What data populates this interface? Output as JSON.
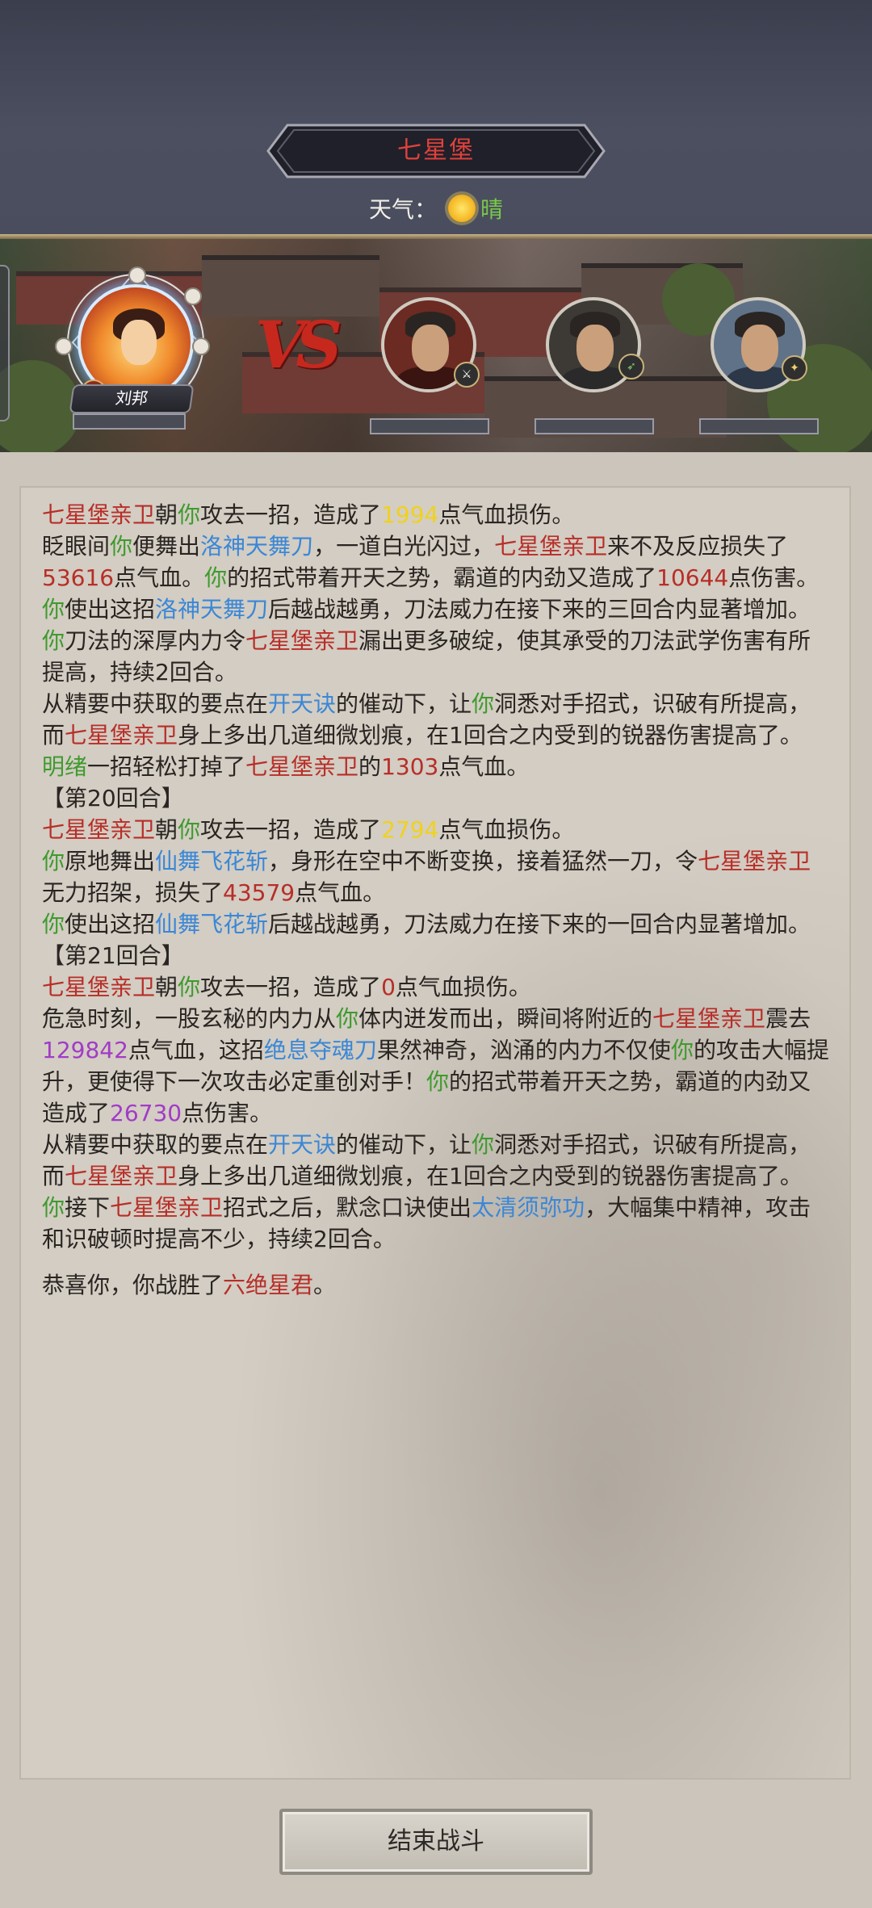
{
  "header": {
    "location": "七星堡",
    "weather_label": "天气：",
    "weather_icon": "sun-icon",
    "weather_value": "晴"
  },
  "battle": {
    "player_name": "刘邦",
    "vs_label": "VS"
  },
  "log": [
    {
      "parts": [
        {
          "t": "七星堡亲卫",
          "c": "red"
        },
        {
          "t": "朝"
        },
        {
          "t": "你",
          "c": "green"
        },
        {
          "t": "攻去一招，造成了"
        },
        {
          "t": "1994",
          "c": "yellow"
        },
        {
          "t": "点气血损伤。"
        }
      ]
    },
    {
      "parts": [
        {
          "t": "眨眼间"
        },
        {
          "t": "你",
          "c": "green"
        },
        {
          "t": "便舞出"
        },
        {
          "t": "洛神天舞刀",
          "c": "blue"
        },
        {
          "t": "，一道白光闪过，"
        },
        {
          "t": "七星堡亲卫",
          "c": "red"
        },
        {
          "t": "来不及反应损失了"
        },
        {
          "t": "53616",
          "c": "red"
        },
        {
          "t": "点气血。"
        },
        {
          "t": "你",
          "c": "green"
        },
        {
          "t": "的招式带着开天之势，霸道的内劲又造成了"
        },
        {
          "t": "10644",
          "c": "red"
        },
        {
          "t": "点伤害。"
        }
      ]
    },
    {
      "parts": [
        {
          "t": "你",
          "c": "green"
        },
        {
          "t": "使出这招"
        },
        {
          "t": "洛神天舞刀",
          "c": "blue"
        },
        {
          "t": "后越战越勇，刀法威力在接下来的三回合内显著增加。"
        }
      ]
    },
    {
      "parts": [
        {
          "t": "你",
          "c": "green"
        },
        {
          "t": "刀法的深厚内力令"
        },
        {
          "t": "七星堡亲卫",
          "c": "red"
        },
        {
          "t": "漏出更多破绽，使其承受的刀法武学伤害有所提高，持续2回合。"
        }
      ]
    },
    {
      "parts": [
        {
          "t": "从精要中获取的要点在"
        },
        {
          "t": "开天诀",
          "c": "blue"
        },
        {
          "t": "的催动下，让"
        },
        {
          "t": "你",
          "c": "green"
        },
        {
          "t": "洞悉对手招式，识破有所提高，而"
        },
        {
          "t": "七星堡亲卫",
          "c": "red"
        },
        {
          "t": "身上多出几道细微划痕，在1回合之内受到的锐器伤害提高了。"
        }
      ]
    },
    {
      "parts": [
        {
          "t": "明绪",
          "c": "green"
        },
        {
          "t": "一招轻松打掉了"
        },
        {
          "t": "七星堡亲卫",
          "c": "red"
        },
        {
          "t": "的"
        },
        {
          "t": "1303",
          "c": "red"
        },
        {
          "t": "点气血。"
        }
      ]
    },
    {
      "round": true,
      "parts": [
        {
          "t": "【第20回合】"
        }
      ]
    },
    {
      "parts": [
        {
          "t": "七星堡亲卫",
          "c": "red"
        },
        {
          "t": "朝"
        },
        {
          "t": "你",
          "c": "green"
        },
        {
          "t": "攻去一招，造成了"
        },
        {
          "t": "2794",
          "c": "yellow"
        },
        {
          "t": "点气血损伤。"
        }
      ]
    },
    {
      "parts": [
        {
          "t": "你",
          "c": "green"
        },
        {
          "t": "原地舞出"
        },
        {
          "t": "仙舞飞花斩",
          "c": "blue"
        },
        {
          "t": "，身形在空中不断变换，接着猛然一刀，令"
        },
        {
          "t": "七星堡亲卫",
          "c": "red"
        },
        {
          "t": "无力招架，损失了"
        },
        {
          "t": "43579",
          "c": "red"
        },
        {
          "t": "点气血。"
        }
      ]
    },
    {
      "parts": [
        {
          "t": "你",
          "c": "green"
        },
        {
          "t": "使出这招"
        },
        {
          "t": "仙舞飞花斩",
          "c": "blue"
        },
        {
          "t": "后越战越勇，刀法威力在接下来的一回合内显著增加。"
        }
      ]
    },
    {
      "round": true,
      "parts": [
        {
          "t": "【第21回合】"
        }
      ]
    },
    {
      "parts": [
        {
          "t": "七星堡亲卫",
          "c": "red"
        },
        {
          "t": "朝"
        },
        {
          "t": "你",
          "c": "green"
        },
        {
          "t": "攻去一招，造成了"
        },
        {
          "t": "0",
          "c": "red"
        },
        {
          "t": "点气血损伤。"
        }
      ]
    },
    {
      "parts": [
        {
          "t": "危急时刻，一股玄秘的内力从"
        },
        {
          "t": "你",
          "c": "green"
        },
        {
          "t": "体内迸发而出，瞬间将附近的"
        },
        {
          "t": "七星堡亲卫",
          "c": "red"
        },
        {
          "t": "震去"
        },
        {
          "t": "129842",
          "c": "purple"
        },
        {
          "t": "点气血，这招"
        },
        {
          "t": "绝息夺魂刀",
          "c": "blue"
        },
        {
          "t": "果然神奇，汹涌的内力不仅使"
        },
        {
          "t": "你",
          "c": "green"
        },
        {
          "t": "的攻击大幅提升，更使得下一次攻击必定重创对手！"
        },
        {
          "t": "你",
          "c": "green"
        },
        {
          "t": "的招式带着开天之势，霸道的内劲又造成了"
        },
        {
          "t": "26730",
          "c": "purple"
        },
        {
          "t": "点伤害。"
        }
      ]
    },
    {
      "parts": [
        {
          "t": "从精要中获取的要点在"
        },
        {
          "t": "开天诀",
          "c": "blue"
        },
        {
          "t": "的催动下，让"
        },
        {
          "t": "你",
          "c": "green"
        },
        {
          "t": "洞悉对手招式，识破有所提高，而"
        },
        {
          "t": "七星堡亲卫",
          "c": "red"
        },
        {
          "t": "身上多出几道细微划痕，在1回合之内受到的锐器伤害提高了。"
        }
      ]
    },
    {
      "parts": [
        {
          "t": "你",
          "c": "green"
        },
        {
          "t": "接下"
        },
        {
          "t": "七星堡亲卫",
          "c": "red"
        },
        {
          "t": "招式之后，默念口诀使出"
        },
        {
          "t": "太清须弥功",
          "c": "blue"
        },
        {
          "t": "，大幅集中精神，攻击和识破顿时提高不少，持续2回合。"
        }
      ]
    },
    {
      "gap": true,
      "parts": [
        {
          "t": "恭喜你，你战胜了"
        },
        {
          "t": "六绝星君",
          "c": "red"
        },
        {
          "t": "。"
        }
      ]
    }
  ],
  "footer": {
    "end_button": "结束战斗"
  }
}
